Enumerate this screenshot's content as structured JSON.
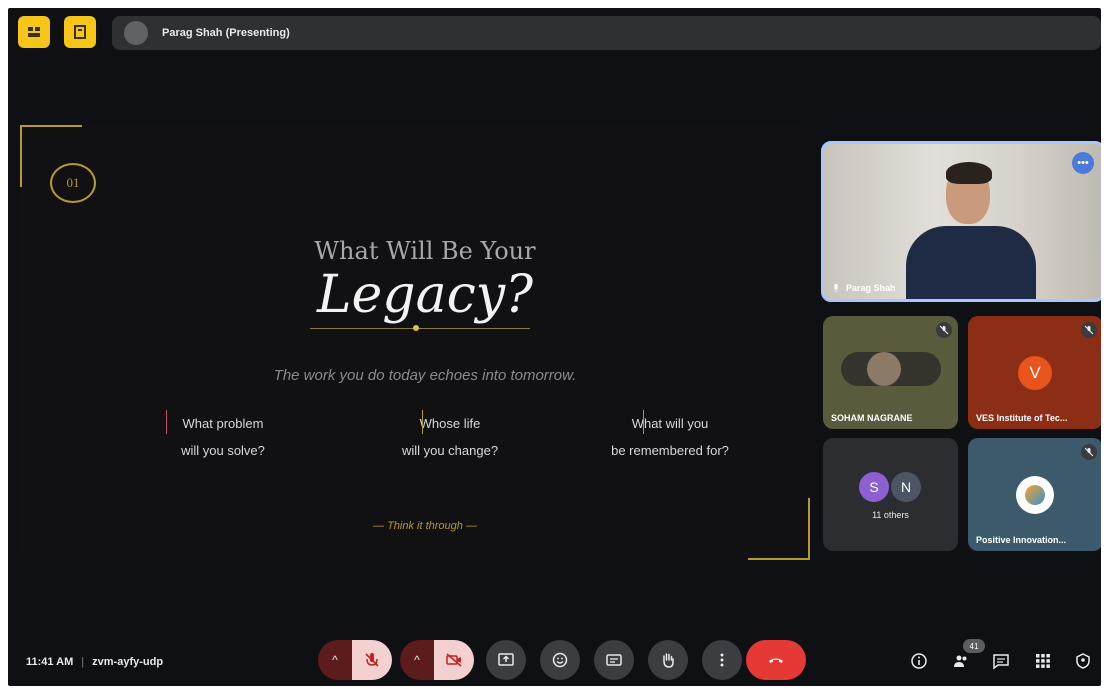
{
  "top_bar": {
    "pin_icon": "pin-grid-icon",
    "cc_icon": "captions-icon",
    "presenting_title": "Parag Shah (Presenting)",
    "accent": "#f5c518"
  },
  "slide": {
    "badge": "01",
    "heading": "What Will Be Your",
    "title": "Legacy?",
    "subtitle": "The work you do today echoes into tomorrow.",
    "columns": [
      {
        "line1": "What problem",
        "line2": "will you solve?"
      },
      {
        "line1": "Whose life",
        "line2": "will you change?"
      },
      {
        "line1": "What will you",
        "line2": "be remembered for?"
      }
    ],
    "footer": "— Think it through —",
    "accent": "#b59a2e"
  },
  "participants": {
    "main": {
      "name": "Parag Shah"
    },
    "sohan": {
      "name": "SOHAM NAGRANE"
    },
    "ves": {
      "initial": "V",
      "name": "VES Institute of Tec..."
    },
    "others": {
      "initial1": "S",
      "initial2": "N",
      "label": "11 others"
    },
    "positive": {
      "name": "Positive Innovation..."
    }
  },
  "bottom_bar": {
    "time": "11:41 AM",
    "separator": "|",
    "meeting_code": "zvm-ayfy-udp",
    "people_count": "41",
    "end_call_color": "#e53935"
  }
}
